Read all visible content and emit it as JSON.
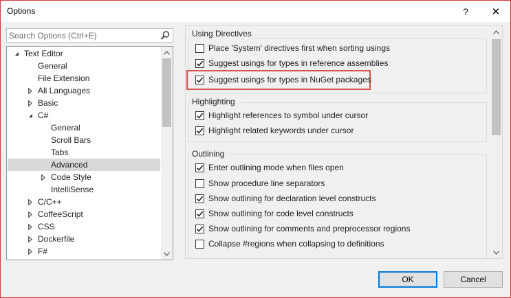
{
  "window": {
    "title": "Options",
    "help_glyph": "?",
    "close_glyph": "✕"
  },
  "search": {
    "placeholder": "Search Options (Ctrl+E)",
    "icon": "search-icon"
  },
  "tree": {
    "items": [
      {
        "label": "Text Editor",
        "expander": "◢",
        "level": 0,
        "selected": false
      },
      {
        "label": "General",
        "expander": "",
        "level": 1,
        "selected": false
      },
      {
        "label": "File Extension",
        "expander": "",
        "level": 1,
        "selected": false
      },
      {
        "label": "All Languages",
        "expander": "▷",
        "level": 1,
        "selected": false
      },
      {
        "label": "Basic",
        "expander": "▷",
        "level": 1,
        "selected": false
      },
      {
        "label": "C#",
        "expander": "◢",
        "level": 1,
        "selected": false
      },
      {
        "label": "General",
        "expander": "",
        "level": 2,
        "selected": false
      },
      {
        "label": "Scroll Bars",
        "expander": "",
        "level": 2,
        "selected": false
      },
      {
        "label": "Tabs",
        "expander": "",
        "level": 2,
        "selected": false
      },
      {
        "label": "Advanced",
        "expander": "",
        "level": 2,
        "selected": true
      },
      {
        "label": "Code Style",
        "expander": "▷",
        "level": 2,
        "selected": false
      },
      {
        "label": "IntelliSense",
        "expander": "",
        "level": 2,
        "selected": false
      },
      {
        "label": "C/C++",
        "expander": "▷",
        "level": 1,
        "selected": false
      },
      {
        "label": "CoffeeScript",
        "expander": "▷",
        "level": 1,
        "selected": false
      },
      {
        "label": "CSS",
        "expander": "▷",
        "level": 1,
        "selected": false
      },
      {
        "label": "Dockerfile",
        "expander": "▷",
        "level": 1,
        "selected": false
      },
      {
        "label": "F#",
        "expander": "▷",
        "level": 1,
        "selected": false
      }
    ]
  },
  "groups": {
    "using_directives": {
      "title": "Using Directives",
      "options": [
        {
          "label": "Place 'System' directives first when sorting usings",
          "checked": false
        },
        {
          "label": "Suggest usings for types in reference assemblies",
          "checked": true
        },
        {
          "label": "Suggest usings for types in NuGet packages",
          "checked": true
        }
      ]
    },
    "highlighting": {
      "title": "Highlighting",
      "options": [
        {
          "label": "Highlight references to symbol under cursor",
          "checked": true
        },
        {
          "label": "Highlight related keywords under cursor",
          "checked": true
        }
      ]
    },
    "outlining": {
      "title": "Outlining",
      "options": [
        {
          "label": "Enter outlining mode when files open",
          "checked": true
        },
        {
          "label": "Show procedure line separators",
          "checked": false
        },
        {
          "label": "Show outlining for declaration level constructs",
          "checked": true
        },
        {
          "label": "Show outlining for code level constructs",
          "checked": true
        },
        {
          "label": "Show outlining for comments and preprocessor regions",
          "checked": true
        },
        {
          "label": "Collapse #regions when collapsing to definitions",
          "checked": false
        }
      ]
    }
  },
  "buttons": {
    "ok": "OK",
    "cancel": "Cancel"
  },
  "colors": {
    "accent": "#0078d7",
    "highlight_border": "#d9534f",
    "selected_row": "#d9d9d9"
  }
}
